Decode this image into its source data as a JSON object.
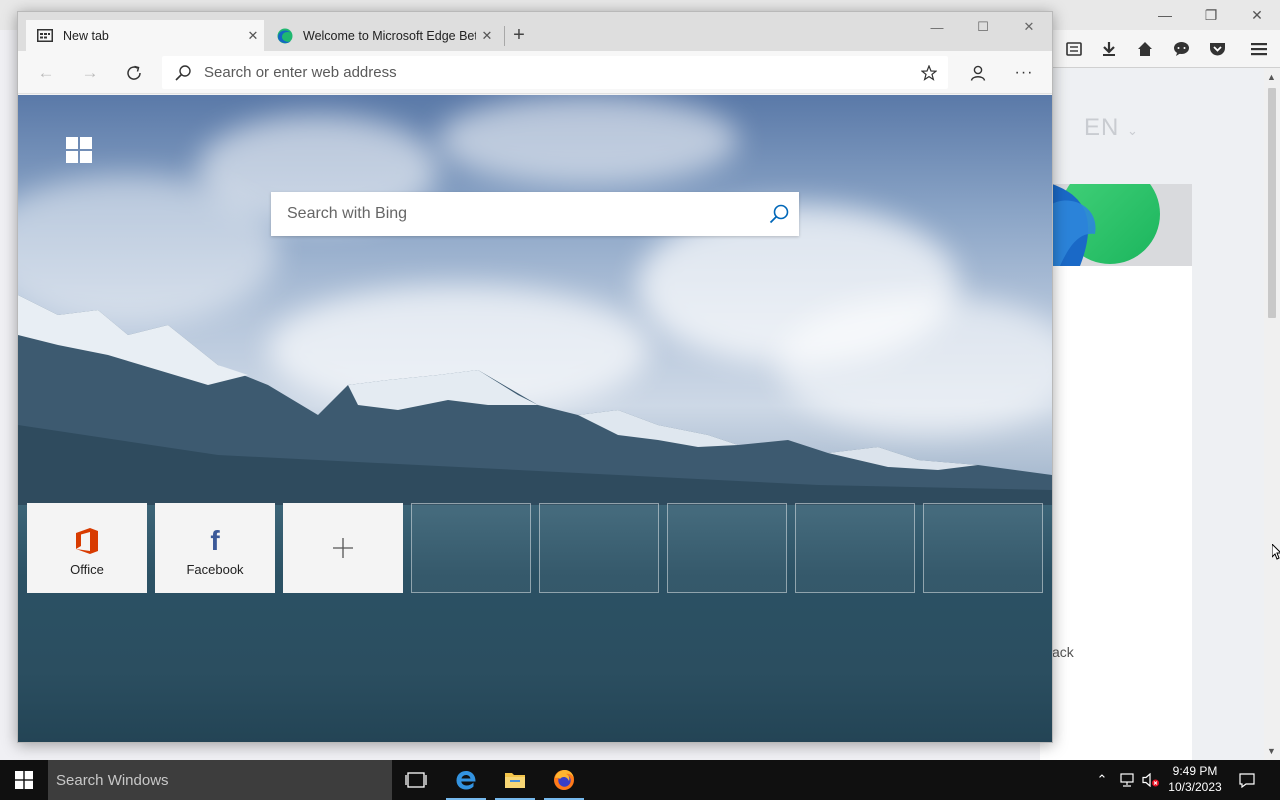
{
  "background_window": {
    "language": "EN",
    "partial_text": "ack",
    "window_controls": [
      "minimize",
      "restore",
      "close"
    ]
  },
  "edge": {
    "tabs": [
      {
        "title": "New tab",
        "icon": "newtab-page-icon",
        "active": true
      },
      {
        "title": "Welcome to Microsoft Edge Beta",
        "icon": "edge-logo-icon",
        "active": false
      }
    ],
    "address_placeholder": "Search or enter web address",
    "search_placeholder": "Search with Bing",
    "top_sites": [
      {
        "label": "Office",
        "icon": "office-icon"
      },
      {
        "label": "Facebook",
        "icon": "facebook-icon"
      },
      {
        "label": "",
        "icon": "add-icon"
      }
    ],
    "empty_tile_count": 5
  },
  "taskbar": {
    "search_placeholder": "Search Windows",
    "time": "9:49 PM",
    "date": "10/3/2023",
    "apps": [
      "task-view-icon",
      "edge-icon",
      "file-explorer-icon",
      "firefox-icon"
    ]
  },
  "colors": {
    "accent_blue": "#0078d7",
    "office_red": "#d83b01",
    "facebook_blue": "#3b5998",
    "taskbar": "#101010"
  }
}
